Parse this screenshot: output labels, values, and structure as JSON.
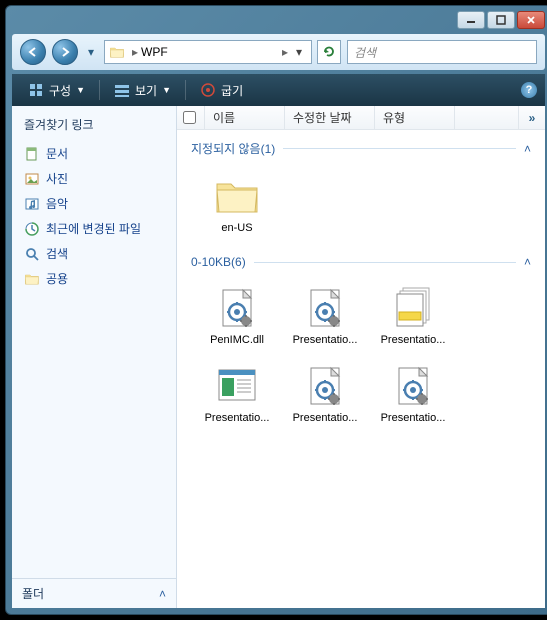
{
  "breadcrumb": {
    "segment1": "WPF",
    "arrow": "▶"
  },
  "search": {
    "placeholder": "검색"
  },
  "toolbar": {
    "organize": "구성",
    "view": "보기",
    "burn": "굽기"
  },
  "sidebar": {
    "header": "즐겨찾기 링크",
    "items": [
      {
        "label": "문서",
        "type": "doc"
      },
      {
        "label": "사진",
        "type": "pic"
      },
      {
        "label": "음악",
        "type": "music"
      },
      {
        "label": "최근에 변경된 파일",
        "type": "recent"
      },
      {
        "label": "검색",
        "type": "search"
      },
      {
        "label": "공용",
        "type": "public"
      }
    ],
    "footer": "폴더"
  },
  "columns": {
    "name": "이름",
    "modified": "수정한 날짜",
    "type": "유형",
    "more": "»"
  },
  "groups": [
    {
      "title": "지정되지 않음(1)",
      "items": [
        {
          "label": "en-US",
          "kind": "folder"
        }
      ]
    },
    {
      "title": "0-10KB(6)",
      "items": [
        {
          "label": "PenIMC.dll",
          "kind": "config"
        },
        {
          "label": "Presentatio...",
          "kind": "config"
        },
        {
          "label": "Presentatio...",
          "kind": "stack"
        },
        {
          "label": "Presentatio...",
          "kind": "doc"
        },
        {
          "label": "Presentatio...",
          "kind": "config"
        },
        {
          "label": "Presentatio...",
          "kind": "config"
        }
      ]
    }
  ]
}
